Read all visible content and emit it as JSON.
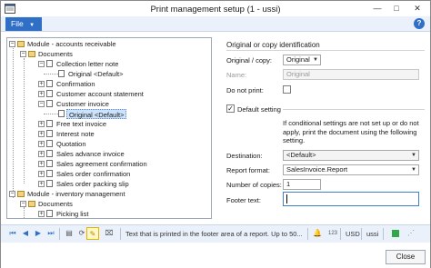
{
  "window": {
    "title": "Print management setup (1 - ussi)"
  },
  "menu": {
    "file_label": "File",
    "help_icon": "help-icon"
  },
  "tree": {
    "module_ar": "Module - accounts receivable",
    "documents_ar": "Documents",
    "collection_letter": "Collection letter note",
    "original_default_1": "Original <Default>",
    "confirmation": "Confirmation",
    "customer_account_statement": "Customer account statement",
    "customer_invoice": "Customer invoice",
    "original_default_2": "Original <Default>",
    "free_text_invoice": "Free text invoice",
    "interest_note": "Interest note",
    "quotation": "Quotation",
    "sales_advance_invoice": "Sales advance invoice",
    "sales_agreement_confirmation": "Sales agreement confirmation",
    "sales_order_confirmation": "Sales order confirmation",
    "sales_order_packing_slip": "Sales order packing slip",
    "module_inv": "Module - inventory management",
    "documents_inv": "Documents",
    "picking_list": "Picking list"
  },
  "form": {
    "section_title": "Original or copy identification",
    "original_copy_label": "Original / copy:",
    "original_copy_value": "Original",
    "name_label": "Name:",
    "name_value": "Original",
    "do_not_print_label": "Do not print:",
    "do_not_print_checked": false,
    "default_setting_label": "Default setting",
    "default_setting_checked": true,
    "info_text": "If conditional settings are not set up or do not apply, print the document using the following setting.",
    "destination_label": "Destination:",
    "destination_value": "<Default>",
    "report_format_label": "Report format:",
    "report_format_value": "SalesInvoice.Report",
    "copies_label": "Number of copies:",
    "copies_value": "1",
    "footer_label": "Footer text:",
    "footer_value": ""
  },
  "statusbar": {
    "status_text": "Text that is printed in the footer area of a report. Up to 50...",
    "currency": "USD",
    "company": "ussi"
  },
  "bottom": {
    "close_label": "Close"
  }
}
